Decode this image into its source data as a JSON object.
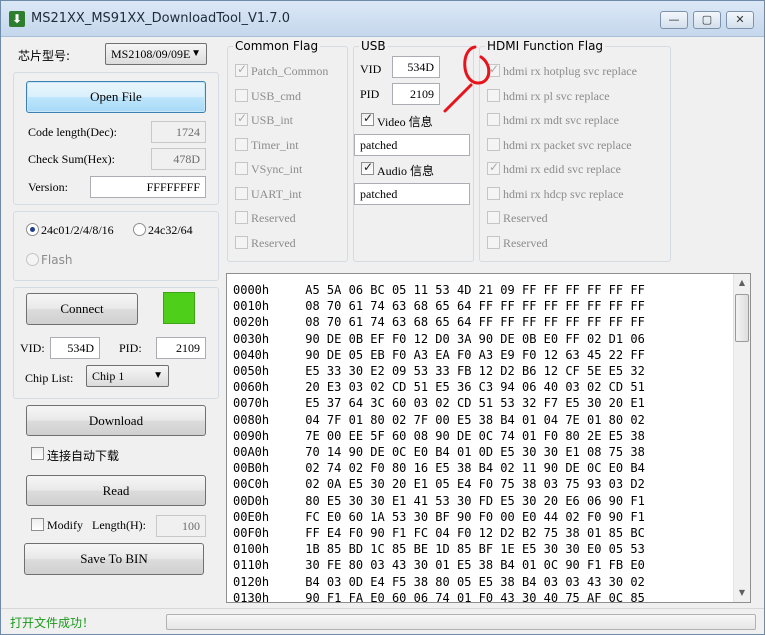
{
  "window": {
    "title": "MS21XX_MS91XX_DownloadTool_V1.7.0",
    "min": "—",
    "max": "▢",
    "close": "✕"
  },
  "chip_model": {
    "label": "芯片型号:",
    "value": "MS2108/09/09E"
  },
  "file": {
    "open_button": "Open File",
    "code_length_label": "Code length(Dec):",
    "code_length": "1724",
    "checksum_label": "Check Sum(Hex):",
    "checksum": "478D",
    "version_label": "Version:",
    "version": "FFFFFFFF"
  },
  "eeprom": {
    "opt1": "24c01/2/4/8/16",
    "opt2": "24c32/64",
    "opt3": "Flash",
    "selected": "opt1"
  },
  "connection": {
    "connect_button": "Connect",
    "status_color": "#4ed01a",
    "vid_label": "VID:",
    "vid": "534D",
    "pid_label": "PID:",
    "pid": "2109",
    "chiplist_label": "Chip List:",
    "chiplist": "Chip 1"
  },
  "actions": {
    "download": "Download",
    "auto_download_label": "连接自动下载",
    "read": "Read",
    "modify_label": "Modify",
    "length_label": "Length(H):",
    "length_value": "100",
    "save_bin": "Save To BIN"
  },
  "common_flag": {
    "title": "Common Flag",
    "items": [
      {
        "label": "Patch_Common",
        "checked": true,
        "disabled": true
      },
      {
        "label": "USB_cmd",
        "checked": false,
        "disabled": true
      },
      {
        "label": "USB_int",
        "checked": true,
        "disabled": true
      },
      {
        "label": "Timer_int",
        "checked": false,
        "disabled": true
      },
      {
        "label": "VSync_int",
        "checked": false,
        "disabled": true
      },
      {
        "label": "UART_int",
        "checked": false,
        "disabled": true
      },
      {
        "label": "Reserved",
        "checked": false,
        "disabled": true
      },
      {
        "label": "Reserved",
        "checked": false,
        "disabled": true
      }
    ]
  },
  "usb": {
    "title": "USB",
    "vid_label": "VID",
    "vid": "534D",
    "pid_label": "PID",
    "pid": "2109",
    "video_label": "Video 信息",
    "video_value": "patched",
    "audio_label": "Audio 信息",
    "audio_value": "patched"
  },
  "hdmi_flag": {
    "title": "HDMI Function Flag",
    "items": [
      {
        "label": "hdmi rx hotplug svc replace",
        "checked": true
      },
      {
        "label": "hdmi rx pl svc replace",
        "checked": false
      },
      {
        "label": "hdmi rx mdt svc replace",
        "checked": false
      },
      {
        "label": "hdmi rx packet svc replace",
        "checked": false
      },
      {
        "label": "hdmi rx edid svc replace",
        "checked": true
      },
      {
        "label": "hdmi rx hdcp svc replace",
        "checked": false
      },
      {
        "label": "Reserved",
        "checked": false
      },
      {
        "label": "Reserved",
        "checked": false
      }
    ]
  },
  "hex_rows": [
    "0000h     A5 5A 06 BC 05 11 53 4D 21 09 FF FF FF FF FF FF",
    "0010h     08 70 61 74 63 68 65 64 FF FF FF FF FF FF FF FF",
    "0020h     08 70 61 74 63 68 65 64 FF FF FF FF FF FF FF FF",
    "0030h     90 DE 0B EF F0 12 D0 3A 90 DE 0B E0 FF 02 D1 06",
    "0040h     90 DE 05 EB F0 A3 EA F0 A3 E9 F0 12 63 45 22 FF",
    "0050h     E5 33 30 E2 09 53 33 FB 12 D2 B6 12 CF 5E E5 32",
    "0060h     20 E3 03 02 CD 51 E5 36 C3 94 06 40 03 02 CD 51",
    "0070h     E5 37 64 3C 60 03 02 CD 51 53 32 F7 E5 30 20 E1",
    "0080h     04 7F 01 80 02 7F 00 E5 38 B4 01 04 7E 01 80 02",
    "0090h     7E 00 EE 5F 60 08 90 DE 0C 74 01 F0 80 2E E5 38",
    "00A0h     70 14 90 DE 0C E0 B4 01 0D E5 30 30 E1 08 75 38",
    "00B0h     02 74 02 F0 80 16 E5 38 B4 02 11 90 DE 0C E0 B4",
    "00C0h     02 0A E5 30 20 E1 05 E4 F0 75 38 03 75 93 03 D2",
    "00D0h     80 E5 30 30 E1 41 53 30 FD E5 30 20 E6 06 90 F1",
    "00E0h     FC E0 60 1A 53 30 BF 90 F0 00 E0 44 02 F0 90 F1",
    "00F0h     FF E4 F0 90 F1 FC 04 F0 12 D2 B2 75 38 01 85 BC",
    "0100h     1B 85 BD 1C 85 BE 1D 85 BF 1E E5 30 30 E0 05 53",
    "0110h     30 FE 80 03 43 30 01 E5 38 B4 01 0C 90 F1 FB E0",
    "0120h     B4 03 0D E4 F5 38 80 05 E5 38 B4 03 03 43 30 02",
    "0130h     90 F1 FA E0 60 06 74 01 F0 43 30 40 75 AF 0C 85"
  ],
  "statusbar": {
    "text": "打开文件成功！",
    "color": "#1a9a1a"
  },
  "annotation": {
    "color": "#e8141b"
  }
}
